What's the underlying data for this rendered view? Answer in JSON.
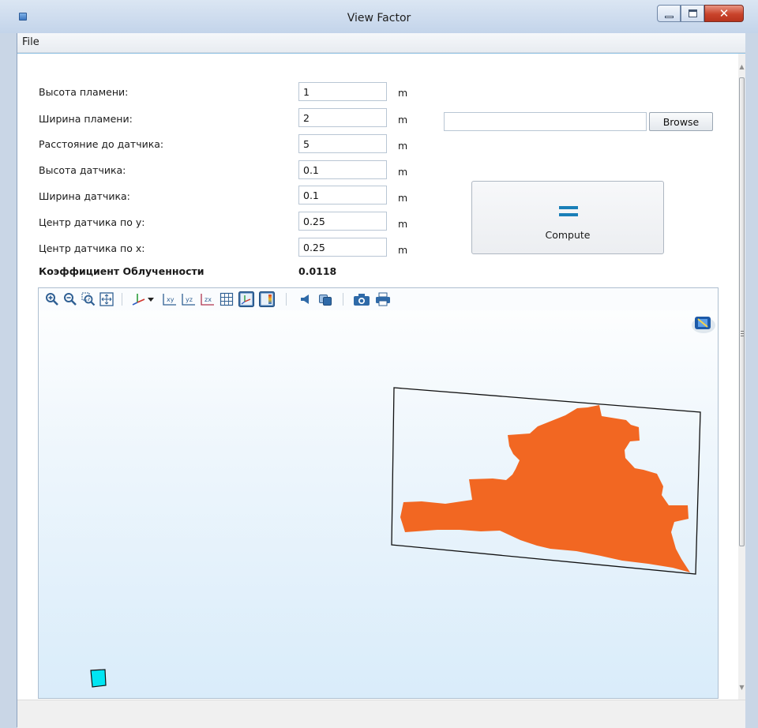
{
  "window": {
    "title": "View Factor"
  },
  "menu": {
    "file": "File"
  },
  "fields": [
    {
      "label": "Высота пламени:",
      "value": "1",
      "unit": "m"
    },
    {
      "label": "Ширина пламени:",
      "value": "2",
      "unit": "m"
    },
    {
      "label": "Расстояние до датчика:",
      "value": "5",
      "unit": "m"
    },
    {
      "label": "Высота датчика:",
      "value": "0.1",
      "unit": "m"
    },
    {
      "label": "Ширина датчика:",
      "value": "0.1",
      "unit": "m"
    },
    {
      "label": "Центр датчика по у:",
      "value": "0.25",
      "unit": "m"
    },
    {
      "label": "Центр датчика по х:",
      "value": "0.25",
      "unit": "m"
    }
  ],
  "result": {
    "label": "Коэффициент Облученности",
    "value": "0.0118"
  },
  "file_picker": {
    "value": "",
    "browse_label": "Browse"
  },
  "compute": {
    "label": "Compute"
  },
  "viewport": {
    "toolbar_icons": [
      "zoom-in-icon",
      "zoom-out-icon",
      "zoom-box-icon",
      "zoom-extents-icon",
      "axis-orientation-icon",
      "dropdown-arrow-icon",
      "xy-plane-view-icon",
      "yz-plane-view-icon",
      "zx-plane-view-icon",
      "grid-icon",
      "show-axes-toggle-icon",
      "color-legend-toggle-icon",
      "light-icon",
      "transparency-icon",
      "camera-snapshot-icon",
      "print-icon"
    ],
    "flame_color": "#f26722",
    "sensor_color": "#00e5f2"
  },
  "colors": {
    "accent": "#1a7fb8",
    "viewport_bg_top": "#ffffff",
    "viewport_bg_bottom": "#d9ecfa"
  }
}
